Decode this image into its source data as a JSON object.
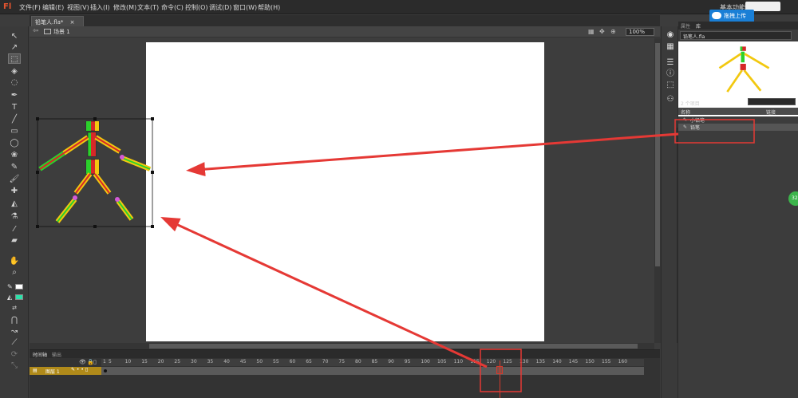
{
  "app": {
    "logo": "Fl"
  },
  "menu": {
    "items": [
      "文件(F)",
      "编辑(E)",
      "视图(V)",
      "插入(I)",
      "修改(M)",
      "文本(T)",
      "命令(C)",
      "控制(O)",
      "调试(D)",
      "窗口(W)",
      "帮助(H)"
    ],
    "workspace": "基本功能"
  },
  "upload_popup": "拖拽上传",
  "document": {
    "tab_label": "铅笔人.fla*",
    "close_icon": "×",
    "scene_label": "场景 1",
    "zoom": "100%"
  },
  "timeline": {
    "tab_timeline": "时间轴",
    "tab_output": "输出",
    "layer_name": "图层 1",
    "ruler": [
      "1",
      "5",
      "10",
      "15",
      "20",
      "25",
      "30",
      "35",
      "40",
      "45",
      "50",
      "55",
      "60",
      "65",
      "70",
      "75",
      "80",
      "85",
      "90",
      "95",
      "100",
      "105",
      "110",
      "115",
      "120",
      "125",
      "130",
      "135",
      "140",
      "145",
      "150",
      "155",
      "160"
    ],
    "current_frame": "120"
  },
  "library": {
    "tab_properties": "属性",
    "tab_library": "库",
    "file_select": "铅笔人.fla",
    "item_count": "2 个项目",
    "col_name": "名称",
    "col_linkage": "链接",
    "items": [
      "小铅笔",
      "铅笔"
    ]
  },
  "badge": "32",
  "colors": {
    "accent_red": "#e53935",
    "stroke_color": "#ffffff",
    "fill_color": "#2de0a8",
    "layer_highlight": "#b08a1a"
  }
}
